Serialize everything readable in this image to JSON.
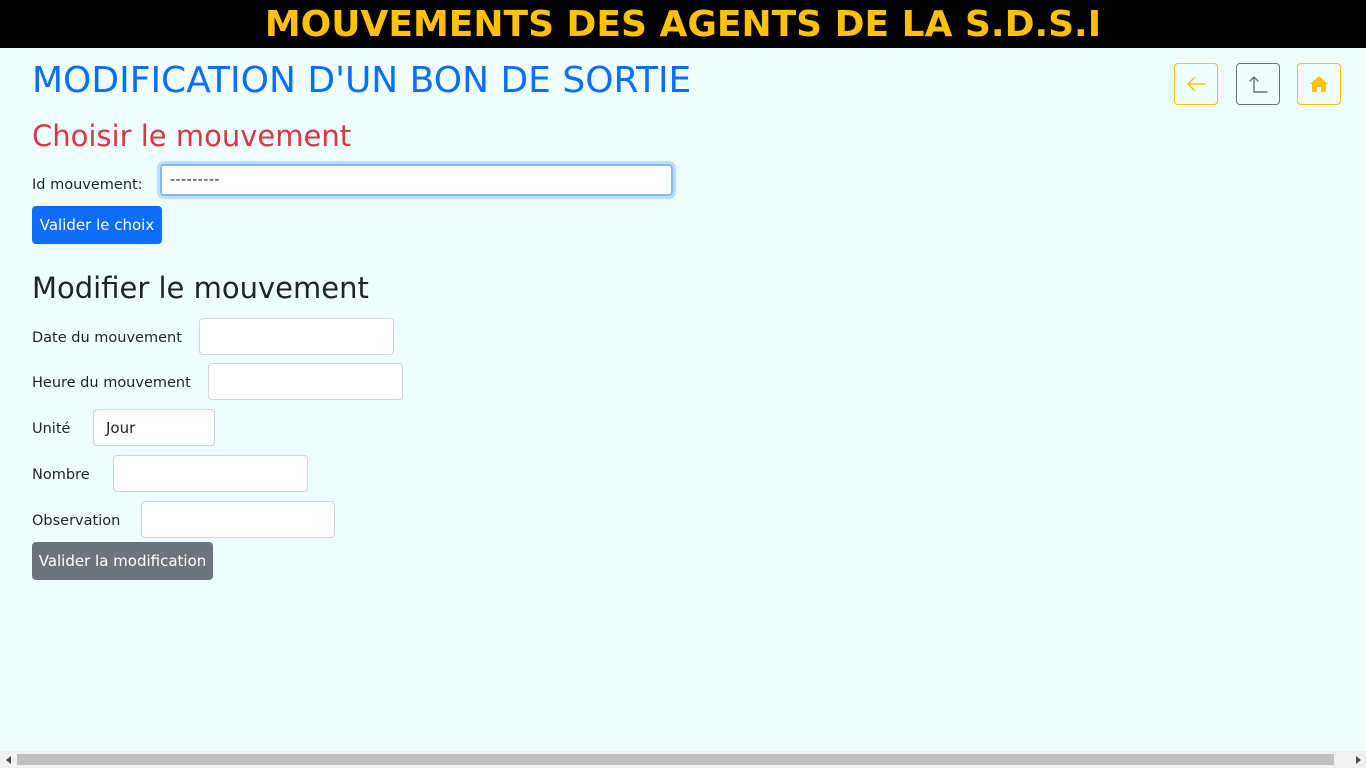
{
  "banner": {
    "title": "MOUVEMENTS DES AGENTS DE LA S.D.S.I"
  },
  "page_title": "MODIFICATION D'UN BON DE SORTIE",
  "nav": {
    "back_icon": "arrow-left-icon",
    "up_icon": "arrow-up-turn-icon",
    "home_icon": "home-icon"
  },
  "choose_section": {
    "title": "Choisir le mouvement",
    "id_label": "Id mouvement:",
    "id_value": "---------",
    "submit_label": "Valider le choix"
  },
  "edit_section": {
    "title": "Modifier le mouvement",
    "date_label": "Date du mouvement",
    "date_value": "",
    "time_label": "Heure du mouvement",
    "time_value": "",
    "unit_label": "Unité",
    "unit_value": "Jour",
    "count_label": "Nombre",
    "count_value": "",
    "observation_label": "Observation",
    "observation_value": "",
    "submit_label": "Valider la modification"
  },
  "colors": {
    "banner_bg": "#000000",
    "banner_text": "#ffc107",
    "page_bg": "#eefffe",
    "title_blue": "#0d6efd",
    "section_red": "#dc3545",
    "primary_button": "#0d6efd",
    "secondary_button": "#6c757d"
  }
}
